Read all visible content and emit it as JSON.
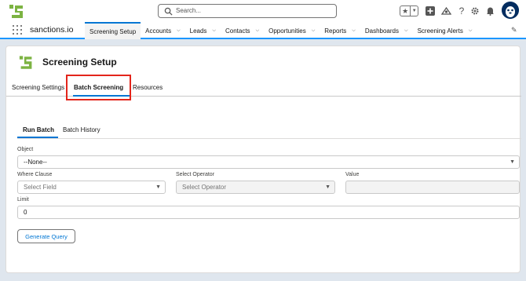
{
  "header": {
    "search_placeholder": "Search..."
  },
  "nav": {
    "app_name": "sanctions.io",
    "items": [
      {
        "label": "Screening Setup",
        "active": true,
        "has_menu": false
      },
      {
        "label": "Accounts",
        "has_menu": true
      },
      {
        "label": "Leads",
        "has_menu": true
      },
      {
        "label": "Contacts",
        "has_menu": true
      },
      {
        "label": "Opportunities",
        "has_menu": true
      },
      {
        "label": "Reports",
        "has_menu": true
      },
      {
        "label": "Dashboards",
        "has_menu": true
      },
      {
        "label": "Screening Alerts",
        "has_menu": true
      }
    ]
  },
  "page": {
    "title": "Screening Setup",
    "tabs": [
      "Screening Settings",
      "Batch Screening",
      "Resources"
    ],
    "active_tab": "Batch Screening",
    "subtabs": [
      "Run Batch",
      "Batch History"
    ],
    "active_subtab": "Run Batch"
  },
  "form": {
    "object_label": "Object",
    "object_value": "--None--",
    "where_label": "Where Clause",
    "where_placeholder": "Select Field",
    "operator_label": "Select Operator",
    "operator_placeholder": "Select Operator",
    "value_label": "Value",
    "value_value": "",
    "limit_label": "Limit",
    "limit_value": "0",
    "generate_button": "Generate Query"
  },
  "colors": {
    "brand_green": "#7cb342",
    "accent_blue": "#0176d3",
    "highlight_red": "#e3251b"
  }
}
